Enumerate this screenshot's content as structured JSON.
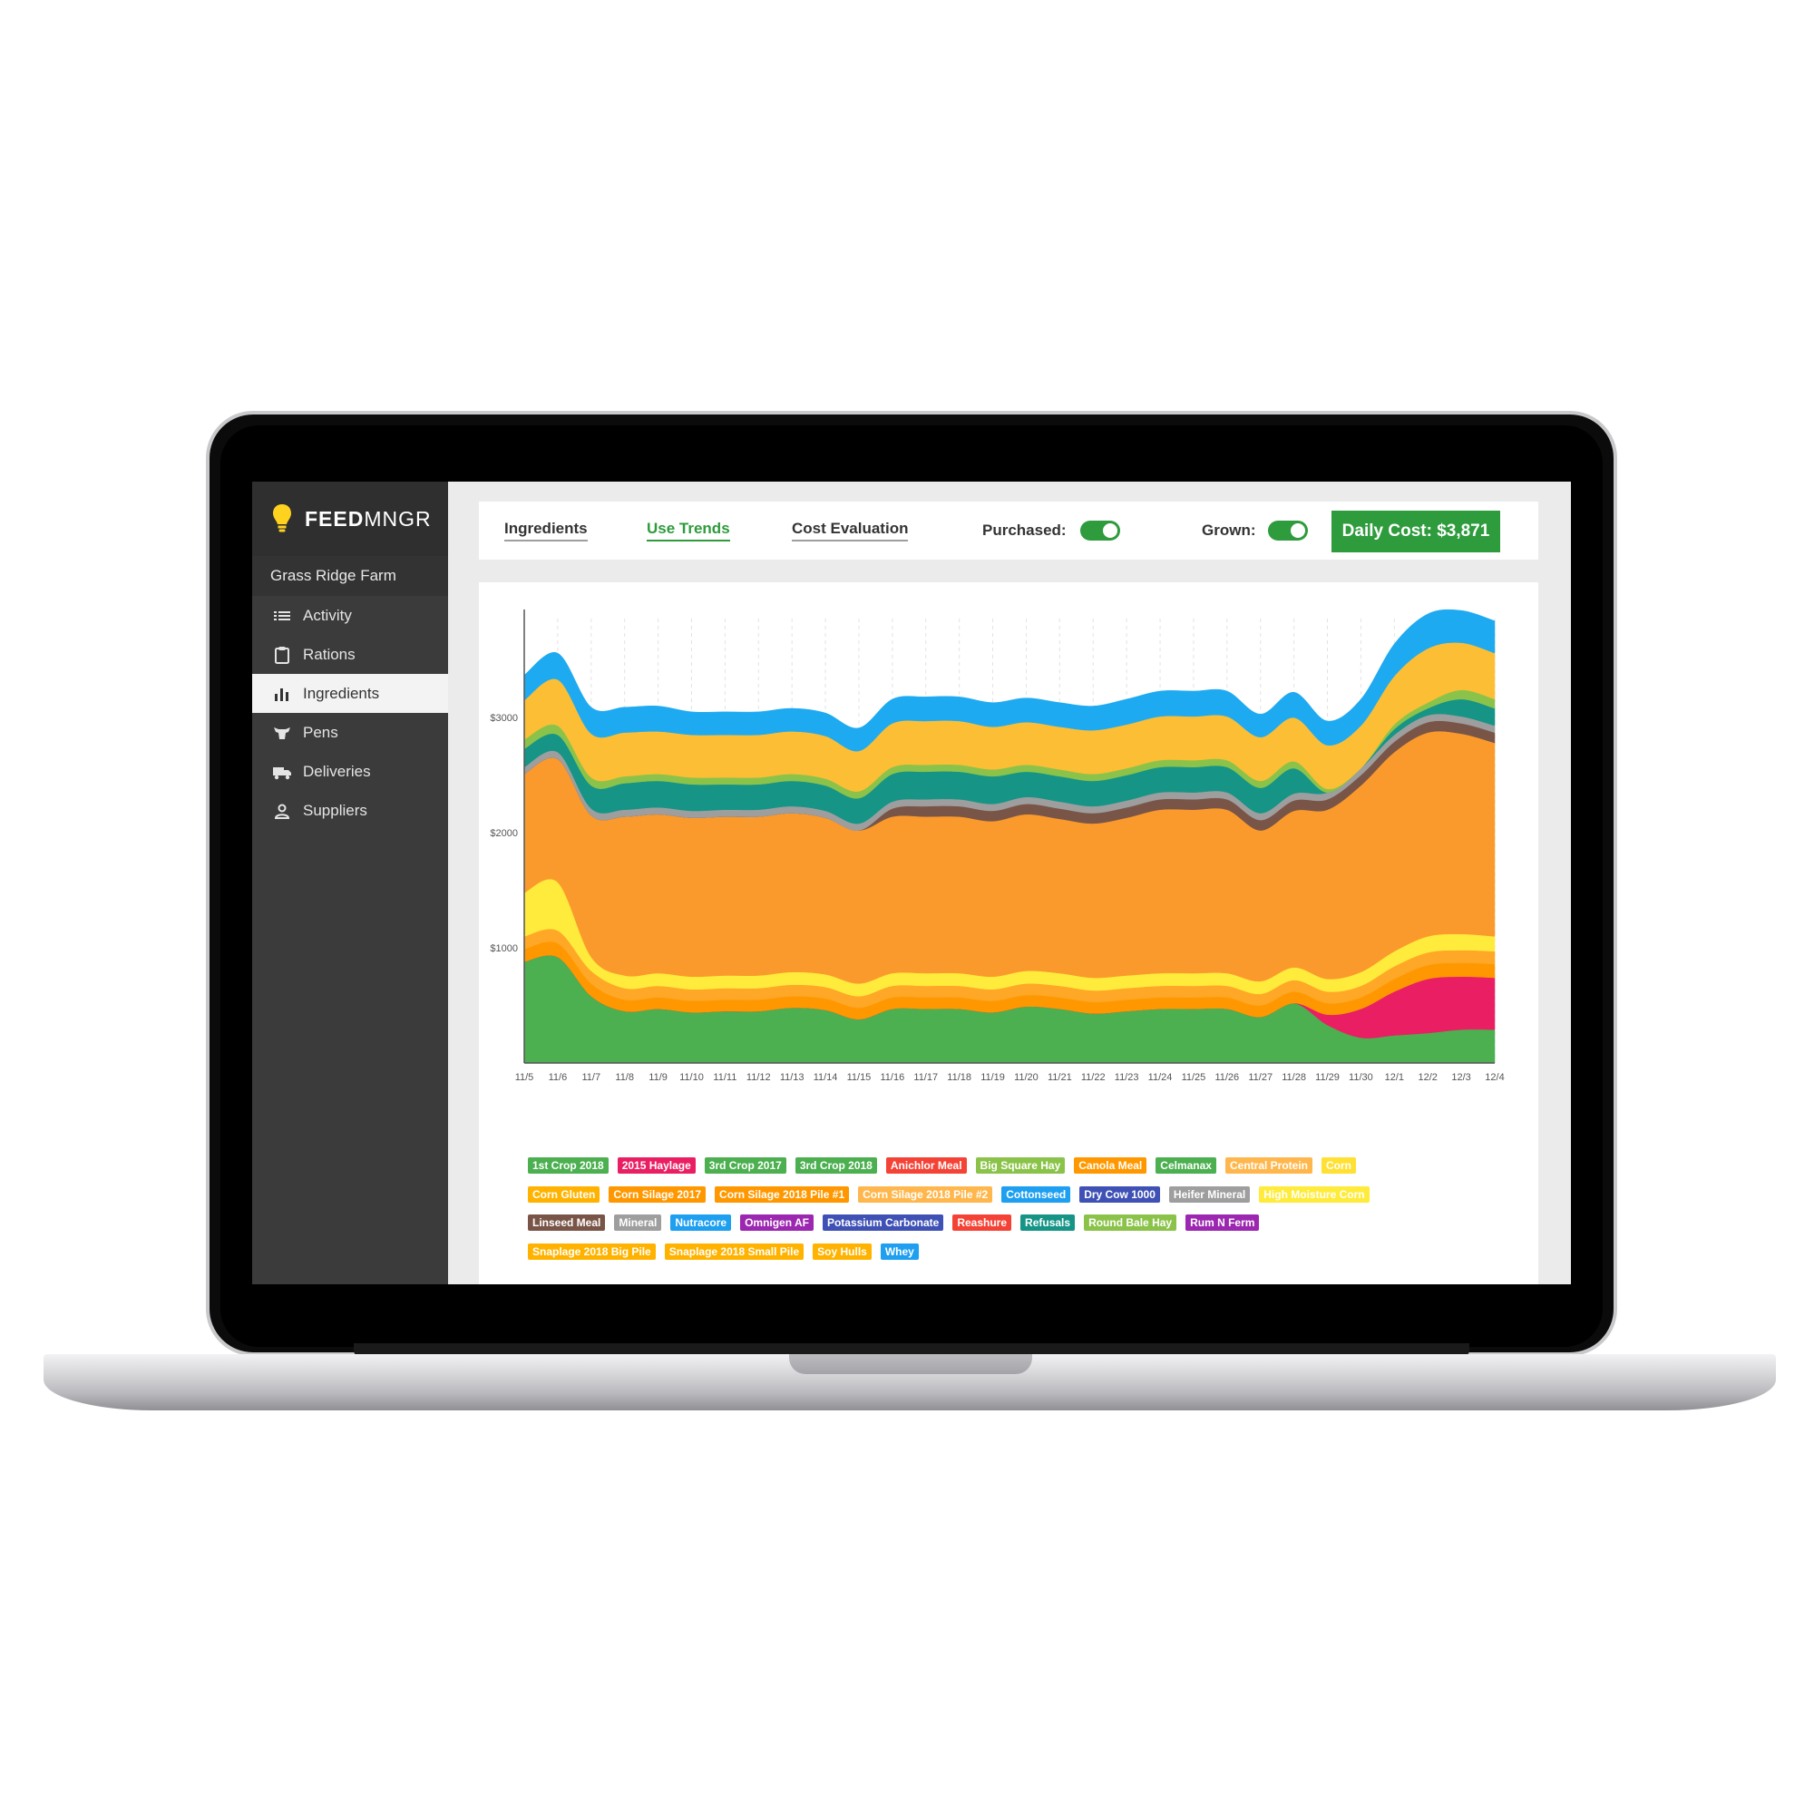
{
  "brand": {
    "bold": "FEED",
    "light": "MNGR"
  },
  "farm_name": "Grass Ridge Farm",
  "nav": [
    {
      "label": "Activity",
      "icon": "list-icon"
    },
    {
      "label": "Rations",
      "icon": "clipboard-icon"
    },
    {
      "label": "Ingredients",
      "icon": "bar-chart-icon",
      "active": true
    },
    {
      "label": "Pens",
      "icon": "cow-icon"
    },
    {
      "label": "Deliveries",
      "icon": "truck-icon"
    },
    {
      "label": "Suppliers",
      "icon": "person-icon"
    }
  ],
  "tabs": [
    {
      "label": "Ingredients"
    },
    {
      "label": "Use Trends",
      "active": true
    },
    {
      "label": "Cost Evaluation"
    }
  ],
  "toggles": {
    "purchased": {
      "label": "Purchased:",
      "on": true
    },
    "grown": {
      "label": "Grown:",
      "on": true
    }
  },
  "daily_cost": "Daily Cost: $3,871",
  "colors": {
    "accent": "#2e9b3c",
    "sidebar": "#3b3b3b"
  },
  "chart_data": {
    "type": "area",
    "stacked": true,
    "x": [
      "11/5",
      "11/6",
      "11/7",
      "11/8",
      "11/9",
      "11/10",
      "11/11",
      "11/12",
      "11/13",
      "11/14",
      "11/15",
      "11/16",
      "11/17",
      "11/18",
      "11/19",
      "11/20",
      "11/21",
      "11/22",
      "11/23",
      "11/24",
      "11/25",
      "11/26",
      "11/27",
      "11/28",
      "11/29",
      "11/30",
      "12/1",
      "12/2",
      "12/3",
      "12/4"
    ],
    "y_ticks": [
      {
        "value": 1000,
        "label": "$1000"
      },
      {
        "value": 2000,
        "label": "$2000"
      },
      {
        "value": 3000,
        "label": "$3000"
      }
    ],
    "ylim": [
      0,
      3860
    ],
    "grid": "vertical-dashed",
    "series": [
      {
        "name": "1st Crop 2018",
        "color": "#4caf50",
        "values": [
          880,
          920,
          580,
          450,
          470,
          440,
          450,
          450,
          480,
          460,
          380,
          470,
          470,
          470,
          440,
          490,
          470,
          430,
          450,
          470,
          470,
          470,
          400,
          520,
          330,
          220,
          240,
          260,
          290,
          290
        ]
      },
      {
        "name": "2015 Haylage",
        "color": "#e91e63",
        "values": [
          0,
          0,
          0,
          0,
          0,
          0,
          0,
          0,
          0,
          0,
          0,
          0,
          0,
          0,
          0,
          0,
          0,
          0,
          0,
          0,
          0,
          0,
          0,
          0,
          90,
          250,
          380,
          470,
          460,
          450
        ]
      },
      {
        "name": "Corn Silage 2018 Pile #1",
        "color": "#ff9800",
        "values": [
          110,
          120,
          110,
          100,
          100,
          100,
          100,
          100,
          100,
          100,
          100,
          100,
          100,
          100,
          100,
          100,
          100,
          100,
          100,
          100,
          100,
          100,
          100,
          100,
          100,
          100,
          110,
          120,
          120,
          120
        ]
      },
      {
        "name": "Corn Silage 2017",
        "color": "#ffa726",
        "values": [
          110,
          110,
          110,
          100,
          100,
          100,
          100,
          100,
          100,
          100,
          100,
          100,
          100,
          100,
          100,
          100,
          100,
          100,
          100,
          100,
          100,
          100,
          100,
          100,
          100,
          100,
          110,
          110,
          110,
          110
        ]
      },
      {
        "name": "High Moisture Corn",
        "color": "#ffeb3b",
        "values": [
          380,
          420,
          120,
          110,
          110,
          110,
          110,
          110,
          110,
          110,
          110,
          110,
          110,
          110,
          110,
          110,
          110,
          110,
          110,
          110,
          110,
          110,
          110,
          110,
          110,
          120,
          130,
          140,
          140,
          130
        ]
      },
      {
        "name": "Snaplage 2018 Big Pile",
        "color": "#fb9a2c",
        "values": [
          1030,
          1070,
          1230,
          1380,
          1380,
          1380,
          1380,
          1380,
          1380,
          1360,
          1330,
          1360,
          1360,
          1360,
          1350,
          1360,
          1340,
          1340,
          1370,
          1420,
          1420,
          1420,
          1310,
          1360,
          1470,
          1620,
          1730,
          1770,
          1740,
          1680
        ]
      },
      {
        "name": "Linseed Meal",
        "color": "#795548",
        "values": [
          0,
          0,
          0,
          0,
          0,
          0,
          0,
          0,
          0,
          0,
          0,
          70,
          90,
          90,
          90,
          90,
          90,
          90,
          90,
          90,
          90,
          90,
          90,
          90,
          90,
          90,
          90,
          90,
          90,
          90
        ]
      },
      {
        "name": "Mineral",
        "color": "#9e9e9e",
        "values": [
          60,
          60,
          60,
          60,
          60,
          60,
          60,
          60,
          60,
          60,
          60,
          60,
          60,
          60,
          60,
          60,
          60,
          60,
          60,
          60,
          60,
          60,
          60,
          60,
          60,
          60,
          60,
          60,
          60,
          60
        ]
      },
      {
        "name": "Refusals",
        "color": "#169486",
        "values": [
          160,
          150,
          200,
          230,
          230,
          230,
          220,
          220,
          220,
          220,
          220,
          240,
          240,
          240,
          240,
          220,
          220,
          220,
          220,
          220,
          220,
          220,
          220,
          220,
          0,
          0,
          50,
          60,
          150,
          150
        ]
      },
      {
        "name": "Round Bale Hay",
        "color": "#8bc34a",
        "values": [
          80,
          80,
          70,
          60,
          60,
          60,
          60,
          60,
          60,
          60,
          60,
          60,
          60,
          60,
          60,
          60,
          60,
          60,
          60,
          60,
          60,
          60,
          60,
          60,
          30,
          0,
          40,
          50,
          80,
          80
        ]
      },
      {
        "name": "Snaplage 2018 Small Pile",
        "color": "#fcbe34",
        "values": [
          340,
          400,
          380,
          380,
          370,
          370,
          370,
          370,
          370,
          370,
          350,
          380,
          380,
          380,
          370,
          370,
          370,
          380,
          380,
          380,
          380,
          380,
          380,
          380,
          380,
          370,
          420,
          470,
          410,
          400
        ]
      },
      {
        "name": "Cottonseed",
        "color": "#1eaaf1",
        "values": [
          220,
          230,
          230,
          220,
          220,
          200,
          200,
          200,
          200,
          200,
          200,
          210,
          210,
          210,
          210,
          210,
          210,
          210,
          220,
          220,
          220,
          220,
          200,
          220,
          210,
          230,
          280,
          300,
          280,
          280
        ]
      }
    ]
  },
  "legend": [
    [
      {
        "label": "1st Crop 2018",
        "color": "#4caf50"
      },
      {
        "label": "2015 Haylage",
        "color": "#e91e63"
      },
      {
        "label": "3rd Crop 2017",
        "color": "#4caf50"
      },
      {
        "label": "3rd Crop 2018",
        "color": "#4caf50"
      },
      {
        "label": "Anichlor Meal",
        "color": "#f44336"
      },
      {
        "label": "Big Square Hay",
        "color": "#8bc34a"
      },
      {
        "label": "Canola Meal",
        "color": "#ff9800"
      },
      {
        "label": "Celmanax",
        "color": "#4caf50"
      },
      {
        "label": "Central Protein",
        "color": "#ffb74d"
      },
      {
        "label": "Corn",
        "color": "#ffe033"
      }
    ],
    [
      {
        "label": "Corn Gluten",
        "color": "#ffb300"
      },
      {
        "label": "Corn Silage 2017",
        "color": "#ff9800"
      },
      {
        "label": "Corn Silage 2018 Pile #1",
        "color": "#ff9800"
      },
      {
        "label": "Corn Silage 2018 Pile #2",
        "color": "#ffb74d"
      },
      {
        "label": "Cottonseed",
        "color": "#1e9ff0"
      },
      {
        "label": "Dry Cow 1000",
        "color": "#3f51b5"
      },
      {
        "label": "Heifer Mineral",
        "color": "#9e9e9e"
      },
      {
        "label": "High Moisture Corn",
        "color": "#ffeb3b"
      }
    ],
    [
      {
        "label": "Linseed Meal",
        "color": "#795548"
      },
      {
        "label": "Mineral",
        "color": "#9e9e9e"
      },
      {
        "label": "Nutracore",
        "color": "#1e9ff0"
      },
      {
        "label": "Omnigen AF",
        "color": "#9c27b0"
      },
      {
        "label": "Potassium Carbonate",
        "color": "#3f51b5"
      },
      {
        "label": "Reashure",
        "color": "#f44336"
      },
      {
        "label": "Refusals",
        "color": "#169486"
      },
      {
        "label": "Round Bale Hay",
        "color": "#8bc34a"
      },
      {
        "label": "Rum N Ferm",
        "color": "#9c27b0"
      }
    ],
    [
      {
        "label": "Snaplage 2018 Big Pile",
        "color": "#ffb300"
      },
      {
        "label": "Snaplage 2018 Small Pile",
        "color": "#ffb300"
      },
      {
        "label": "Soy Hulls",
        "color": "#ffb300"
      },
      {
        "label": "Whey",
        "color": "#1e9ff0"
      }
    ]
  ]
}
